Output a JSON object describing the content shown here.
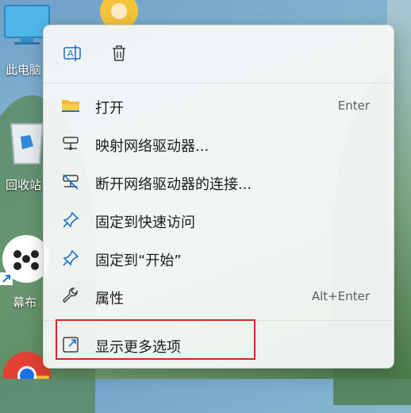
{
  "desktop": {
    "icons": [
      {
        "label": "此电脑"
      },
      {
        "label": "回收站"
      },
      {
        "label": "幕布"
      }
    ]
  },
  "context_menu": {
    "top_actions": [
      {
        "icon": "rename-icon"
      },
      {
        "icon": "delete-icon"
      }
    ],
    "items": [
      {
        "label": "打开",
        "shortcut": "Enter",
        "icon": "folder-icon"
      },
      {
        "label": "映射网络驱动器...",
        "shortcut": "",
        "icon": "network-drive-icon"
      },
      {
        "label": "断开网络驱动器的连接...",
        "shortcut": "",
        "icon": "disconnect-drive-icon"
      },
      {
        "label": "固定到快速访问",
        "shortcut": "",
        "icon": "pin-icon"
      },
      {
        "label": "固定到“开始”",
        "shortcut": "",
        "icon": "pin-icon"
      },
      {
        "label": "属性",
        "shortcut": "Alt+Enter",
        "icon": "wrench-icon"
      }
    ],
    "more_options": {
      "label": "显示更多选项",
      "icon": "more-options-icon"
    },
    "accent_color": "#1e73c8",
    "highlight_color": "#d9242a"
  }
}
